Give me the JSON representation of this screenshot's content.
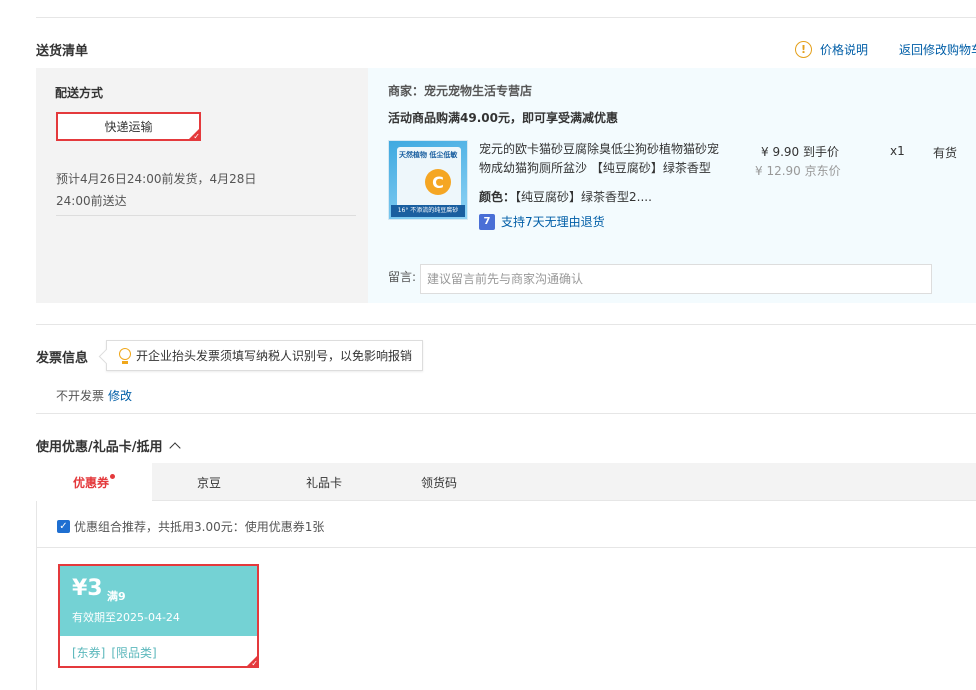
{
  "delivery": {
    "section_title": "送货清单",
    "price_note": "价格说明",
    "price_note_icon": "info-icon",
    "back_link": "返回修改购物车",
    "method_label": "配送方式",
    "method_button": "快递运输",
    "eta_line1": "预计4月26日24:00前发货，4月28日",
    "eta_line2": "24:00前送达"
  },
  "goods": {
    "shop": "商家：宠元宠物生活专营店",
    "promo": "活动商品购满49.00元，即可享受满减优惠",
    "product": {
      "title": "宠元的欧卡猫砂豆腐除臭低尘狗砂植物猫砂宠物成幼猫狗厕所盆沙 【纯豆腐砂】绿茶香型",
      "image_brand": "天然植物 低尘低敏",
      "image_letter": "C",
      "image_tag": "16° 不添流的纯豆腐砂",
      "spec_label": "颜色：",
      "spec_value": "【纯豆腐砂】绿茶香型2....",
      "return_icon": "7",
      "return_text": "支持7天无理由退货",
      "price_now": "¥ 9.90 到手价",
      "price_orig": "¥ 12.90 京东价",
      "qty": "x1",
      "stock": "有货"
    },
    "message_label": "留言:",
    "message_placeholder": "建议留言前先与商家沟通确认"
  },
  "invoice": {
    "title": "发票信息",
    "tip": "开企业抬头发票须填写纳税人识别号，以免影响报销",
    "value": "不开发票",
    "edit": "修改"
  },
  "coupons": {
    "title": "使用优惠/礼品卡/抵用",
    "tabs": [
      {
        "label": "优惠券"
      },
      {
        "label": "京豆"
      },
      {
        "label": "礼品卡"
      },
      {
        "label": "领货码"
      }
    ],
    "combo_text": "优惠组合推荐，共抵用3.00元：使用优惠券1张",
    "coupon": {
      "amount": "¥3",
      "condition": "满9",
      "valid": "有效期至2025-04-24",
      "tag1": "[东券]",
      "tag2": "[限品类]"
    }
  }
}
